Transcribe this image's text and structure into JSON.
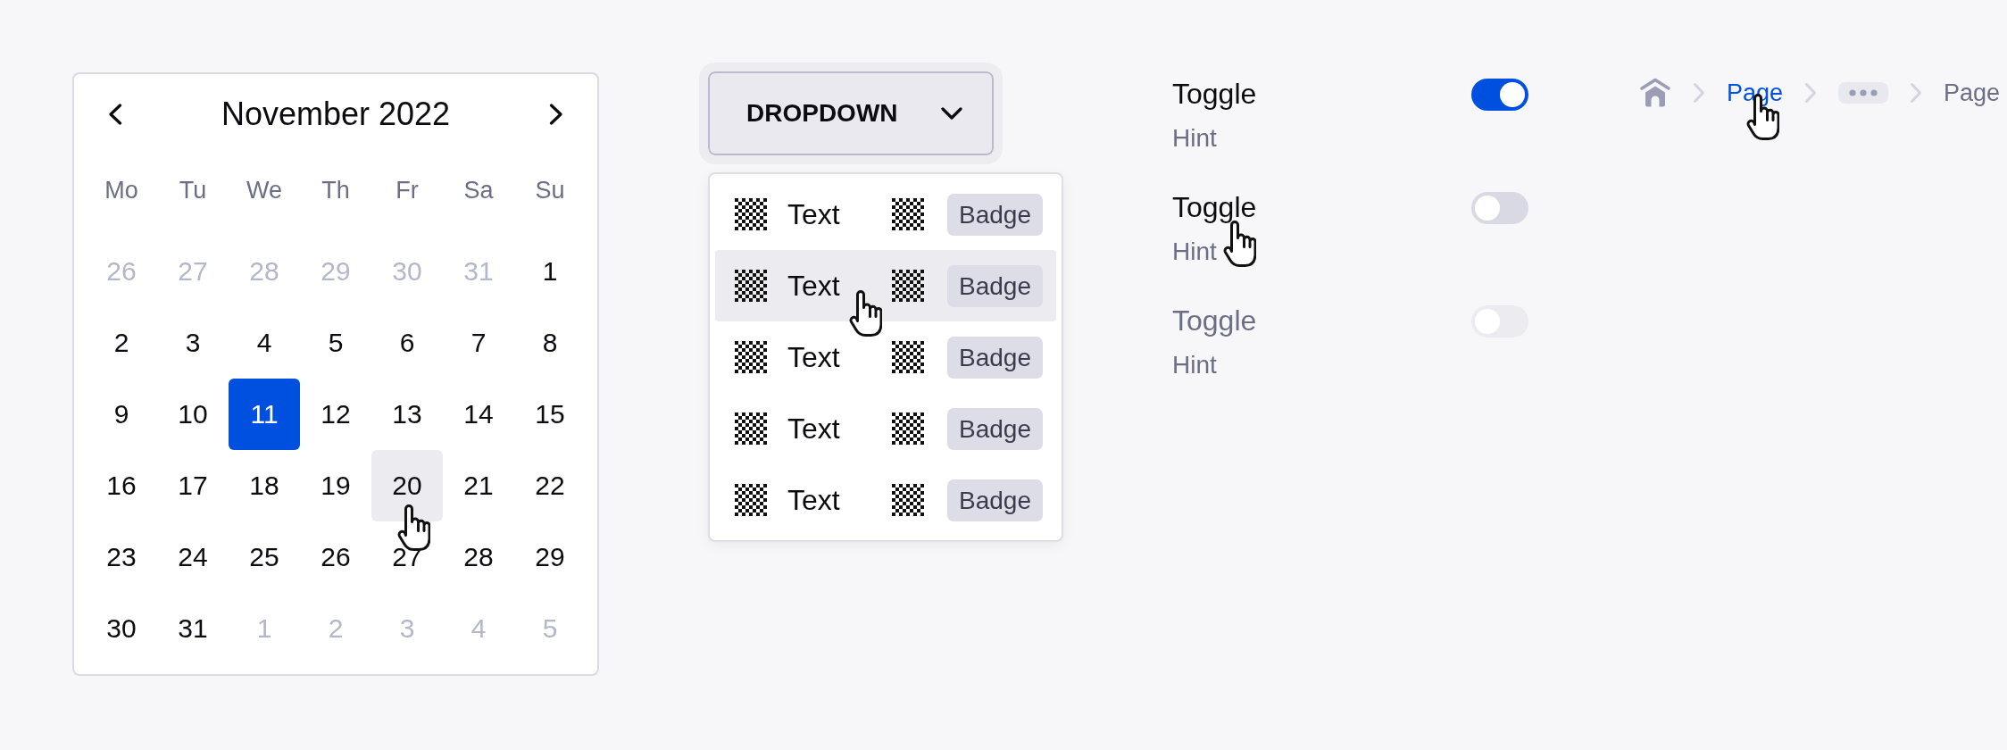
{
  "calendar": {
    "title": "November 2022",
    "weekdays": [
      "Mo",
      "Tu",
      "We",
      "Th",
      "Fr",
      "Sa",
      "Su"
    ],
    "days": [
      {
        "label": "26",
        "outside": true,
        "selected": false,
        "hovered": false
      },
      {
        "label": "27",
        "outside": true,
        "selected": false,
        "hovered": false
      },
      {
        "label": "28",
        "outside": true,
        "selected": false,
        "hovered": false
      },
      {
        "label": "29",
        "outside": true,
        "selected": false,
        "hovered": false
      },
      {
        "label": "30",
        "outside": true,
        "selected": false,
        "hovered": false
      },
      {
        "label": "31",
        "outside": true,
        "selected": false,
        "hovered": false
      },
      {
        "label": "1",
        "outside": false,
        "selected": false,
        "hovered": false
      },
      {
        "label": "2",
        "outside": false,
        "selected": false,
        "hovered": false
      },
      {
        "label": "3",
        "outside": false,
        "selected": false,
        "hovered": false
      },
      {
        "label": "4",
        "outside": false,
        "selected": false,
        "hovered": false
      },
      {
        "label": "5",
        "outside": false,
        "selected": false,
        "hovered": false
      },
      {
        "label": "6",
        "outside": false,
        "selected": false,
        "hovered": false
      },
      {
        "label": "7",
        "outside": false,
        "selected": false,
        "hovered": false
      },
      {
        "label": "8",
        "outside": false,
        "selected": false,
        "hovered": false
      },
      {
        "label": "9",
        "outside": false,
        "selected": false,
        "hovered": false
      },
      {
        "label": "10",
        "outside": false,
        "selected": false,
        "hovered": false
      },
      {
        "label": "11",
        "outside": false,
        "selected": true,
        "hovered": false
      },
      {
        "label": "12",
        "outside": false,
        "selected": false,
        "hovered": false
      },
      {
        "label": "13",
        "outside": false,
        "selected": false,
        "hovered": false
      },
      {
        "label": "14",
        "outside": false,
        "selected": false,
        "hovered": false
      },
      {
        "label": "15",
        "outside": false,
        "selected": false,
        "hovered": false
      },
      {
        "label": "16",
        "outside": false,
        "selected": false,
        "hovered": false
      },
      {
        "label": "17",
        "outside": false,
        "selected": false,
        "hovered": false
      },
      {
        "label": "18",
        "outside": false,
        "selected": false,
        "hovered": false
      },
      {
        "label": "19",
        "outside": false,
        "selected": false,
        "hovered": false
      },
      {
        "label": "20",
        "outside": false,
        "selected": false,
        "hovered": true
      },
      {
        "label": "21",
        "outside": false,
        "selected": false,
        "hovered": false
      },
      {
        "label": "22",
        "outside": false,
        "selected": false,
        "hovered": false
      },
      {
        "label": "23",
        "outside": false,
        "selected": false,
        "hovered": false
      },
      {
        "label": "24",
        "outside": false,
        "selected": false,
        "hovered": false
      },
      {
        "label": "25",
        "outside": false,
        "selected": false,
        "hovered": false
      },
      {
        "label": "26",
        "outside": false,
        "selected": false,
        "hovered": false
      },
      {
        "label": "27",
        "outside": false,
        "selected": false,
        "hovered": false
      },
      {
        "label": "28",
        "outside": false,
        "selected": false,
        "hovered": false
      },
      {
        "label": "29",
        "outside": false,
        "selected": false,
        "hovered": false
      },
      {
        "label": "30",
        "outside": false,
        "selected": false,
        "hovered": false
      },
      {
        "label": "31",
        "outside": false,
        "selected": false,
        "hovered": false
      },
      {
        "label": "1",
        "outside": true,
        "selected": false,
        "hovered": false
      },
      {
        "label": "2",
        "outside": true,
        "selected": false,
        "hovered": false
      },
      {
        "label": "3",
        "outside": true,
        "selected": false,
        "hovered": false
      },
      {
        "label": "4",
        "outside": true,
        "selected": false,
        "hovered": false
      },
      {
        "label": "5",
        "outside": true,
        "selected": false,
        "hovered": false
      }
    ]
  },
  "dropdown": {
    "label": "DROPDOWN",
    "focused": true,
    "expanded": true,
    "items": [
      {
        "text": "Text",
        "badge": "Badge",
        "hovered": false
      },
      {
        "text": "Text",
        "badge": "Badge",
        "hovered": true
      },
      {
        "text": "Text",
        "badge": "Badge",
        "hovered": false
      },
      {
        "text": "Text",
        "badge": "Badge",
        "hovered": false
      },
      {
        "text": "Text",
        "badge": "Badge",
        "hovered": false
      }
    ]
  },
  "toggles": [
    {
      "label": "Toggle",
      "hint": "Hint",
      "on": true,
      "disabled": false,
      "hovered": false
    },
    {
      "label": "Toggle",
      "hint": "Hint",
      "on": false,
      "disabled": false,
      "hovered": true
    },
    {
      "label": "Toggle",
      "hint": "Hint",
      "on": false,
      "disabled": true,
      "hovered": false
    }
  ],
  "breadcrumb": {
    "items": [
      {
        "kind": "home",
        "hovered": false
      },
      {
        "kind": "link",
        "label": "Page",
        "hovered": true
      },
      {
        "kind": "ellipsis",
        "hovered": false
      },
      {
        "kind": "current",
        "label": "Page",
        "hovered": false
      }
    ]
  }
}
